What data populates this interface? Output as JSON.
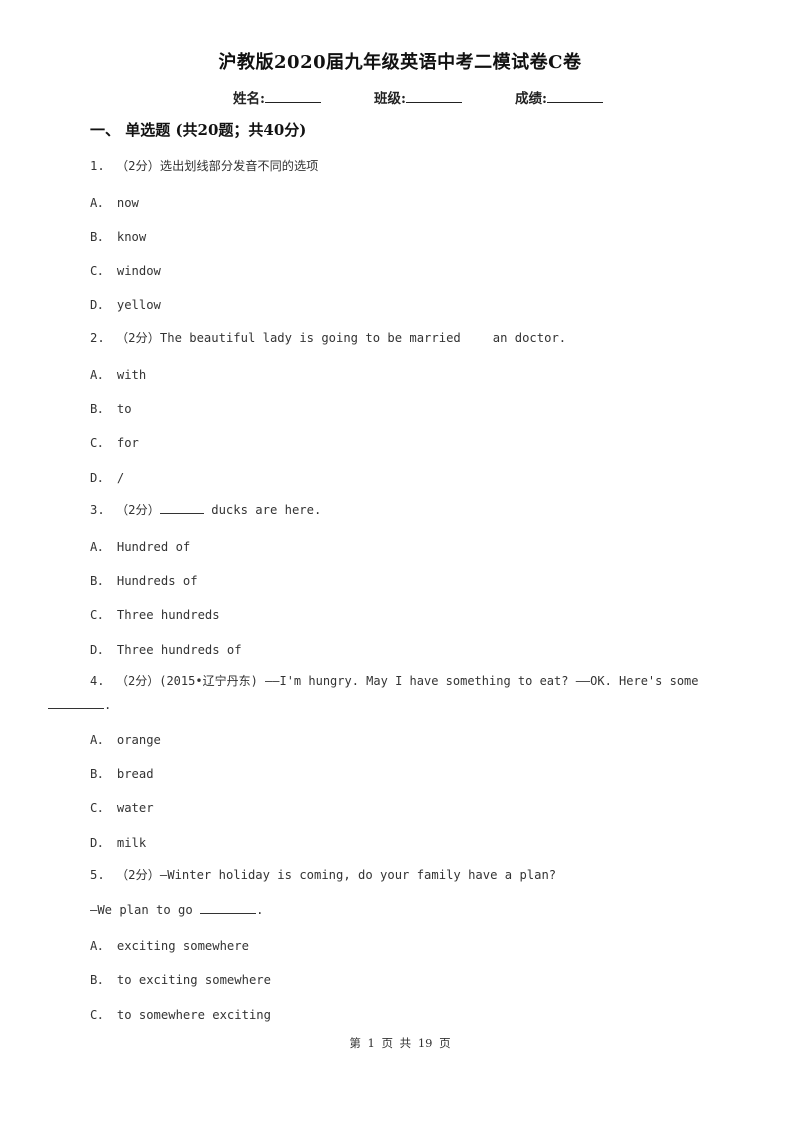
{
  "document": {
    "title": "沪教版2020届九年级英语中考二模试卷C卷",
    "info_fields": [
      {
        "label": "姓名:"
      },
      {
        "label": "班级:"
      },
      {
        "label": "成绩:"
      }
    ],
    "section": {
      "heading": "一、  单选题 (共20题；共40分)"
    },
    "questions": [
      {
        "number": "1.",
        "score": "（2分）",
        "stem": "选出划线部分发音不同的选项",
        "options": [
          {
            "letter": "A．",
            "text": "now"
          },
          {
            "letter": "B．",
            "text": "know"
          },
          {
            "letter": "C．",
            "text": "window"
          },
          {
            "letter": "D．",
            "text": "yellow"
          }
        ]
      },
      {
        "number": "2.",
        "score": "（2分）",
        "stem_before": "The beautiful lady is going to be married",
        "stem_after": "an doctor.",
        "options": [
          {
            "letter": "A．",
            "text": "with"
          },
          {
            "letter": "B．",
            "text": "to"
          },
          {
            "letter": "C．",
            "text": "for"
          },
          {
            "letter": "D．",
            "text": "/"
          }
        ]
      },
      {
        "number": "3.",
        "score": "（2分）",
        "stem_after": "ducks are here.",
        "options": [
          {
            "letter": "A．",
            "text": "Hundred of"
          },
          {
            "letter": "B．",
            "text": "Hundreds of"
          },
          {
            "letter": "C．",
            "text": "Three hundreds"
          },
          {
            "letter": "D．",
            "text": "Three hundreds of"
          }
        ]
      },
      {
        "number": "4.",
        "score": "（2分）",
        "stem": "(2015•辽宁丹东) ——I'm hungry.  May  I  have  something  to  eat?  ——OK.  Here's  some",
        "stem_end": ".",
        "options": [
          {
            "letter": "A．",
            "text": "orange"
          },
          {
            "letter": "B．",
            "text": "bread"
          },
          {
            "letter": "C．",
            "text": "water"
          },
          {
            "letter": "D．",
            "text": "milk"
          }
        ]
      },
      {
        "number": "5.",
        "score": "（2分）",
        "stem": "—Winter holiday is coming, do your family have a plan?",
        "stem_line2_before": "—We plan to go",
        "stem_line2_after": ".",
        "options": [
          {
            "letter": "A．",
            "text": "exciting somewhere"
          },
          {
            "letter": "B．",
            "text": "to exciting somewhere"
          },
          {
            "letter": "C．",
            "text": "to somewhere exciting"
          }
        ]
      }
    ],
    "footer": "第 1 页 共 19 页"
  }
}
